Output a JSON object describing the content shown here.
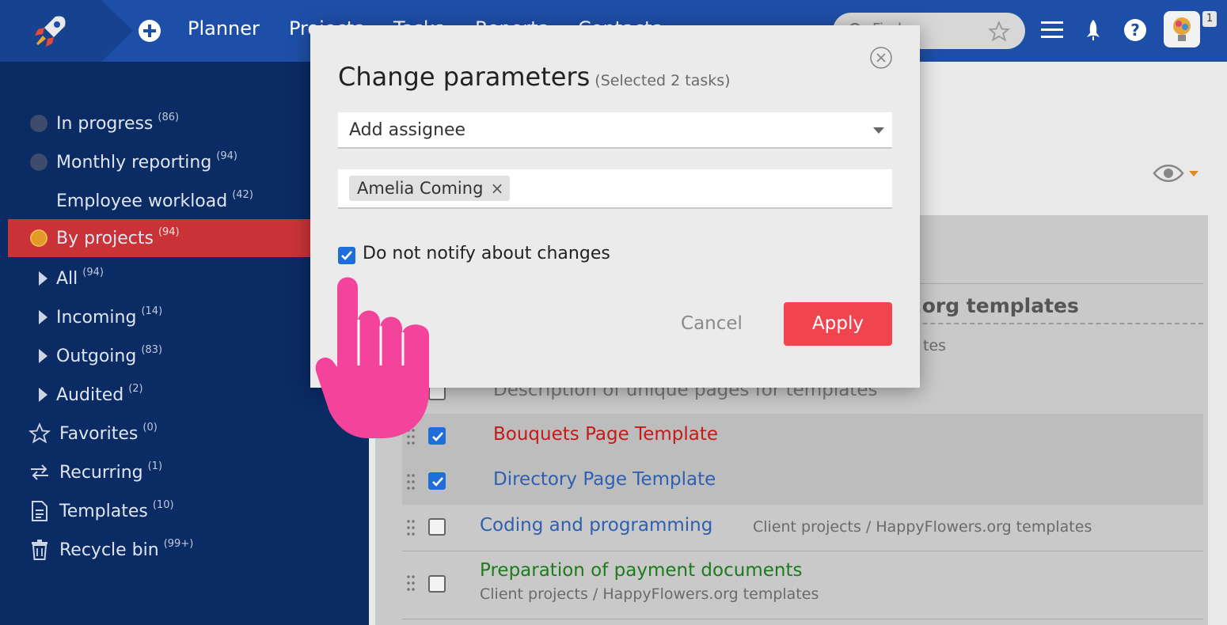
{
  "topbar": {
    "nav": [
      "Planner",
      "Projects",
      "Tasks",
      "Reports",
      "Contacts"
    ],
    "search": {
      "placeholder": "Find..."
    },
    "notification_count": "1"
  },
  "sidebar": {
    "items": [
      {
        "label": "In progress",
        "count": "(86)"
      },
      {
        "label": "Monthly reporting",
        "count": "(94)"
      },
      {
        "label": "Employee workload",
        "count": "(42)"
      },
      {
        "label": "By projects",
        "count": "(94)"
      },
      {
        "label": "All",
        "count": "(94)"
      },
      {
        "label": "Incoming",
        "count": "(14)"
      },
      {
        "label": "Outgoing",
        "count": "(83)"
      },
      {
        "label": "Audited",
        "count": "(2)"
      },
      {
        "label": "Favorites",
        "count": "(0)"
      },
      {
        "label": "Recurring",
        "count": "(1)"
      },
      {
        "label": "Templates",
        "count": "(10)"
      },
      {
        "label": "Recycle bin",
        "count": "(99+)"
      }
    ]
  },
  "main": {
    "group_title": "rs.org templates",
    "group_path_fragment": "tes",
    "tasks": [
      {
        "title": "Description of unique pages for templates",
        "path": ""
      },
      {
        "title": "Bouquets Page Template",
        "path": ""
      },
      {
        "title": "Directory Page Template",
        "path": ""
      },
      {
        "title": "Coding and programming",
        "path": "Client projects / HappyFlowers.org templates"
      },
      {
        "title": "Preparation of payment documents",
        "path": "Client projects / HappyFlowers.org templates"
      }
    ]
  },
  "modal": {
    "title": "Change parameters",
    "subtitle": "(Selected 2 tasks)",
    "select_value": "Add assignee",
    "tag": "Amelia Coming",
    "tag_remove": "×",
    "checkbox_label": "Do not notify about changes",
    "checkbox_checked": true,
    "cancel_label": "Cancel",
    "apply_label": "Apply"
  },
  "colors": {
    "topbar": "#1e4fa8",
    "sidebar": "#0b2b64",
    "active_item": "#c93338",
    "apply": "#f0444f",
    "task_red": "#c41a1a",
    "task_blue": "#2f5fb0",
    "task_green": "#1d7a1d",
    "hand": "#f3439b"
  }
}
